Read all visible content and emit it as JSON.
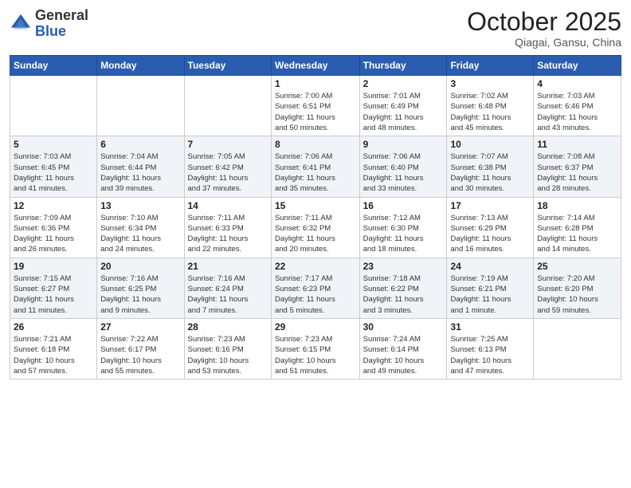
{
  "header": {
    "logo_general": "General",
    "logo_blue": "Blue",
    "month_title": "October 2025",
    "location": "Qiagai, Gansu, China"
  },
  "days_of_week": [
    "Sunday",
    "Monday",
    "Tuesday",
    "Wednesday",
    "Thursday",
    "Friday",
    "Saturday"
  ],
  "weeks": [
    [
      {
        "day": "",
        "info": ""
      },
      {
        "day": "",
        "info": ""
      },
      {
        "day": "",
        "info": ""
      },
      {
        "day": "1",
        "info": "Sunrise: 7:00 AM\nSunset: 6:51 PM\nDaylight: 11 hours\nand 50 minutes."
      },
      {
        "day": "2",
        "info": "Sunrise: 7:01 AM\nSunset: 6:49 PM\nDaylight: 11 hours\nand 48 minutes."
      },
      {
        "day": "3",
        "info": "Sunrise: 7:02 AM\nSunset: 6:48 PM\nDaylight: 11 hours\nand 45 minutes."
      },
      {
        "day": "4",
        "info": "Sunrise: 7:03 AM\nSunset: 6:46 PM\nDaylight: 11 hours\nand 43 minutes."
      }
    ],
    [
      {
        "day": "5",
        "info": "Sunrise: 7:03 AM\nSunset: 6:45 PM\nDaylight: 11 hours\nand 41 minutes."
      },
      {
        "day": "6",
        "info": "Sunrise: 7:04 AM\nSunset: 6:44 PM\nDaylight: 11 hours\nand 39 minutes."
      },
      {
        "day": "7",
        "info": "Sunrise: 7:05 AM\nSunset: 6:42 PM\nDaylight: 11 hours\nand 37 minutes."
      },
      {
        "day": "8",
        "info": "Sunrise: 7:06 AM\nSunset: 6:41 PM\nDaylight: 11 hours\nand 35 minutes."
      },
      {
        "day": "9",
        "info": "Sunrise: 7:06 AM\nSunset: 6:40 PM\nDaylight: 11 hours\nand 33 minutes."
      },
      {
        "day": "10",
        "info": "Sunrise: 7:07 AM\nSunset: 6:38 PM\nDaylight: 11 hours\nand 30 minutes."
      },
      {
        "day": "11",
        "info": "Sunrise: 7:08 AM\nSunset: 6:37 PM\nDaylight: 11 hours\nand 28 minutes."
      }
    ],
    [
      {
        "day": "12",
        "info": "Sunrise: 7:09 AM\nSunset: 6:36 PM\nDaylight: 11 hours\nand 26 minutes."
      },
      {
        "day": "13",
        "info": "Sunrise: 7:10 AM\nSunset: 6:34 PM\nDaylight: 11 hours\nand 24 minutes."
      },
      {
        "day": "14",
        "info": "Sunrise: 7:11 AM\nSunset: 6:33 PM\nDaylight: 11 hours\nand 22 minutes."
      },
      {
        "day": "15",
        "info": "Sunrise: 7:11 AM\nSunset: 6:32 PM\nDaylight: 11 hours\nand 20 minutes."
      },
      {
        "day": "16",
        "info": "Sunrise: 7:12 AM\nSunset: 6:30 PM\nDaylight: 11 hours\nand 18 minutes."
      },
      {
        "day": "17",
        "info": "Sunrise: 7:13 AM\nSunset: 6:29 PM\nDaylight: 11 hours\nand 16 minutes."
      },
      {
        "day": "18",
        "info": "Sunrise: 7:14 AM\nSunset: 6:28 PM\nDaylight: 11 hours\nand 14 minutes."
      }
    ],
    [
      {
        "day": "19",
        "info": "Sunrise: 7:15 AM\nSunset: 6:27 PM\nDaylight: 11 hours\nand 11 minutes."
      },
      {
        "day": "20",
        "info": "Sunrise: 7:16 AM\nSunset: 6:25 PM\nDaylight: 11 hours\nand 9 minutes."
      },
      {
        "day": "21",
        "info": "Sunrise: 7:16 AM\nSunset: 6:24 PM\nDaylight: 11 hours\nand 7 minutes."
      },
      {
        "day": "22",
        "info": "Sunrise: 7:17 AM\nSunset: 6:23 PM\nDaylight: 11 hours\nand 5 minutes."
      },
      {
        "day": "23",
        "info": "Sunrise: 7:18 AM\nSunset: 6:22 PM\nDaylight: 11 hours\nand 3 minutes."
      },
      {
        "day": "24",
        "info": "Sunrise: 7:19 AM\nSunset: 6:21 PM\nDaylight: 11 hours\nand 1 minute."
      },
      {
        "day": "25",
        "info": "Sunrise: 7:20 AM\nSunset: 6:20 PM\nDaylight: 10 hours\nand 59 minutes."
      }
    ],
    [
      {
        "day": "26",
        "info": "Sunrise: 7:21 AM\nSunset: 6:18 PM\nDaylight: 10 hours\nand 57 minutes."
      },
      {
        "day": "27",
        "info": "Sunrise: 7:22 AM\nSunset: 6:17 PM\nDaylight: 10 hours\nand 55 minutes."
      },
      {
        "day": "28",
        "info": "Sunrise: 7:23 AM\nSunset: 6:16 PM\nDaylight: 10 hours\nand 53 minutes."
      },
      {
        "day": "29",
        "info": "Sunrise: 7:23 AM\nSunset: 6:15 PM\nDaylight: 10 hours\nand 51 minutes."
      },
      {
        "day": "30",
        "info": "Sunrise: 7:24 AM\nSunset: 6:14 PM\nDaylight: 10 hours\nand 49 minutes."
      },
      {
        "day": "31",
        "info": "Sunrise: 7:25 AM\nSunset: 6:13 PM\nDaylight: 10 hours\nand 47 minutes."
      },
      {
        "day": "",
        "info": ""
      }
    ]
  ]
}
